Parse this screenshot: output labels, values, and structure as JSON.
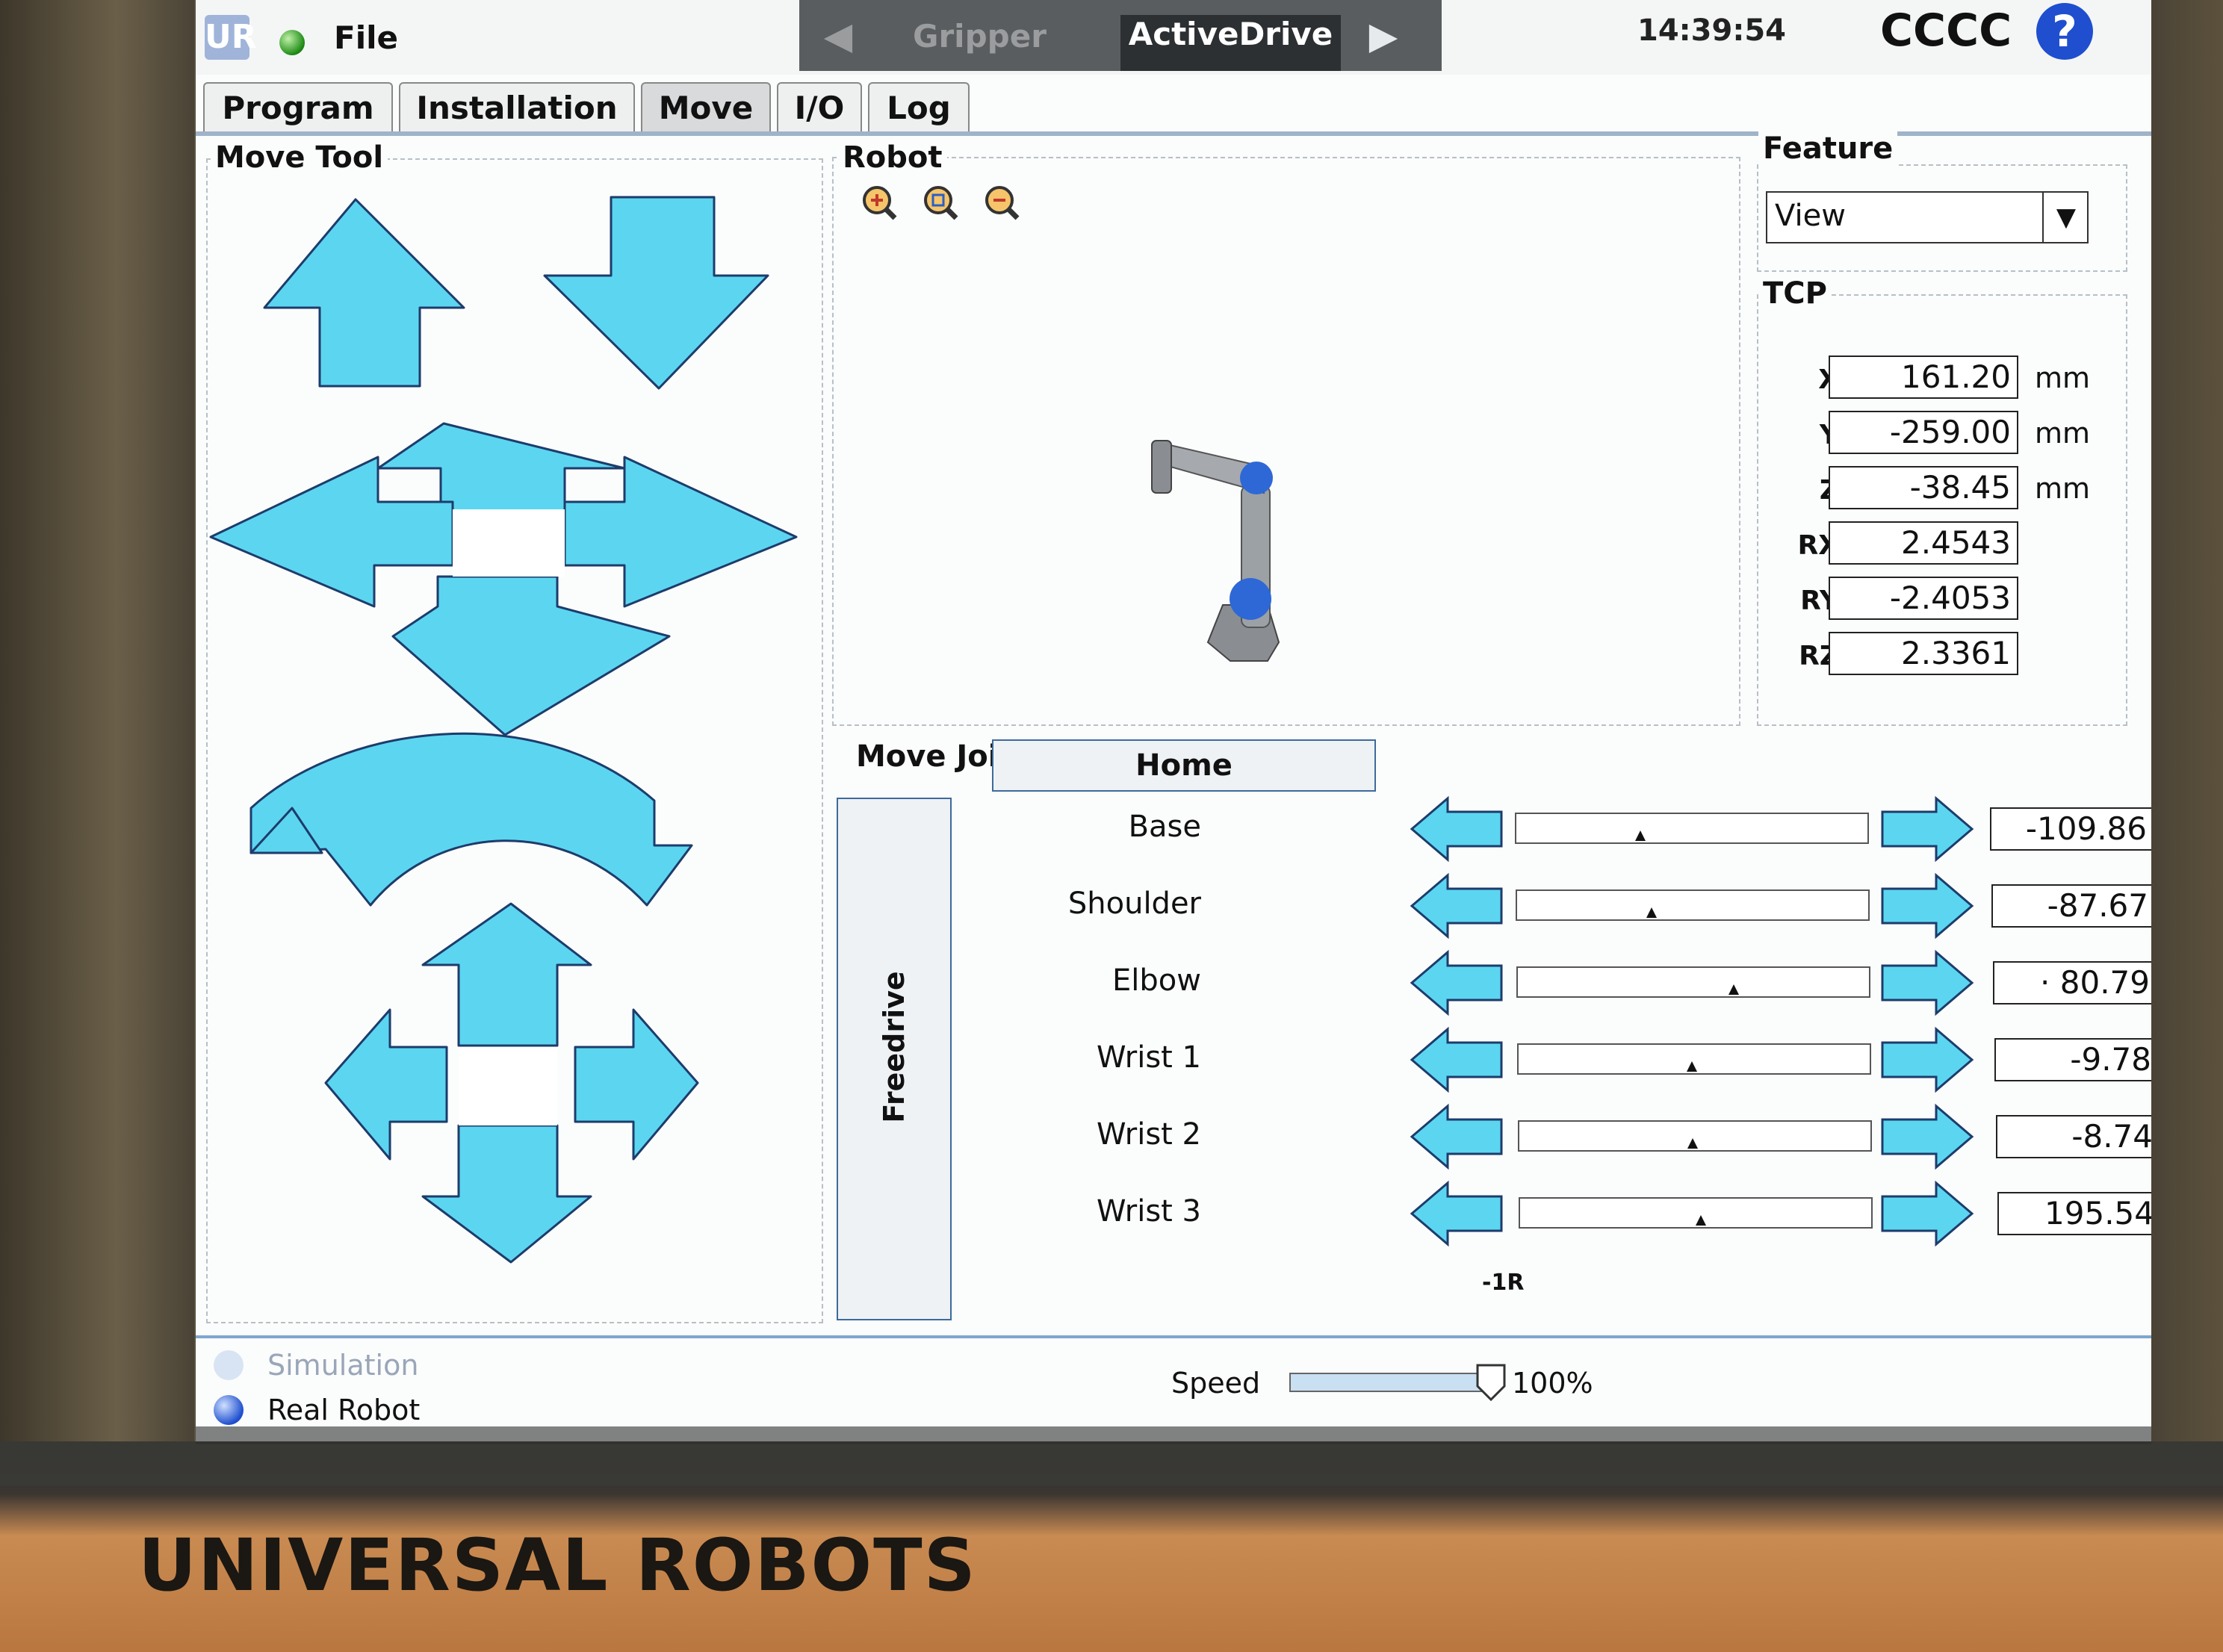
{
  "header": {
    "logo_text": "UR",
    "file_menu": "File",
    "plugin_tabs": [
      "Gripper",
      "ActiveDrive"
    ],
    "active_plugin": "ActiveDrive",
    "clock": "14:39:54",
    "robot_name": "CCCC",
    "help": "?"
  },
  "tabs": [
    "Program",
    "Installation",
    "Move",
    "I/O",
    "Log"
  ],
  "active_tab": "Move",
  "move_tool": {
    "title": "Move Tool"
  },
  "robot_view": {
    "title": "Robot"
  },
  "feature": {
    "title": "Feature",
    "selected": "View"
  },
  "tcp": {
    "title": "TCP",
    "rows": [
      {
        "label": "X",
        "value": "161.20",
        "unit": "mm"
      },
      {
        "label": "Y",
        "value": "-259.00",
        "unit": "mm"
      },
      {
        "label": "Z",
        "value": "-38.45",
        "unit": "mm"
      },
      {
        "label": "RX",
        "value": "2.4543",
        "unit": ""
      },
      {
        "label": "RY",
        "value": "-2.4053",
        "unit": ""
      },
      {
        "label": "RZ",
        "value": "2.3361",
        "unit": ""
      }
    ]
  },
  "move_joints": {
    "title": "Move Joints",
    "freedrive": "Freedrive",
    "home": "Home",
    "degree_symbol": "°",
    "joints": [
      {
        "label": "Base",
        "value": "-109.86",
        "position": 0.35
      },
      {
        "label": "Shoulder",
        "value": "-87.67",
        "position": 0.38
      },
      {
        "label": "Elbow",
        "value": "· 80.79",
        "position": 0.61
      },
      {
        "label": "Wrist 1",
        "value": "-9.78",
        "position": 0.49
      },
      {
        "label": "Wrist 2",
        "value": "-8.74",
        "position": 0.49
      },
      {
        "label": "Wrist 3",
        "value": "195.54",
        "position": 0.51
      }
    ],
    "footer_label": "-1R"
  },
  "footer": {
    "simulation": "Simulation",
    "real_robot": "Real Robot",
    "speed_label": "Speed",
    "speed_value": "100%",
    "speed_level": 1.0
  },
  "device_brand": "UNIVERSAL ROBOTS",
  "colors": {
    "arrow_fill": "#5cd6f0",
    "arrow_stroke": "#1d3c6c",
    "accent_blue": "#1f4fcf"
  }
}
